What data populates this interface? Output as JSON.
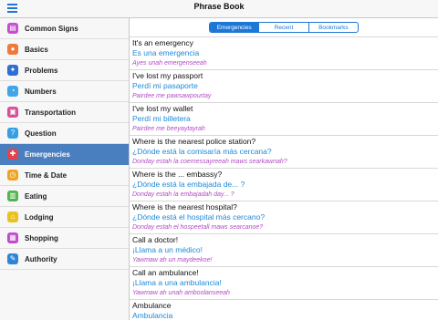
{
  "header": {
    "title": "Phrase Book"
  },
  "sidebar": {
    "items": [
      {
        "label": "Common Signs",
        "icon": "signs-icon",
        "color": "#c94bd1",
        "glyph": "▤"
      },
      {
        "label": "Basics",
        "icon": "chat-icon",
        "color": "#f07a3c",
        "glyph": "●"
      },
      {
        "label": "Problems",
        "icon": "problems-icon",
        "color": "#2d6fd3",
        "glyph": "✦"
      },
      {
        "label": "Numbers",
        "icon": "numbers-icon",
        "color": "#3fa6e8",
        "glyph": "◔"
      },
      {
        "label": "Transportation",
        "icon": "bus-icon",
        "color": "#d94d9a",
        "glyph": "▣"
      },
      {
        "label": "Question",
        "icon": "question-icon",
        "color": "#35a0e6",
        "glyph": "?"
      },
      {
        "label": "Emergencies",
        "icon": "emergency-icon",
        "color": "#e3434a",
        "glyph": "✚"
      },
      {
        "label": "Time & Date",
        "icon": "clock-icon",
        "color": "#f1a421",
        "glyph": "◷"
      },
      {
        "label": "Eating",
        "icon": "eating-icon",
        "color": "#4fb54f",
        "glyph": "▥"
      },
      {
        "label": "Lodging",
        "icon": "home-icon",
        "color": "#e8c21e",
        "glyph": "⌂"
      },
      {
        "label": "Shopping",
        "icon": "cart-icon",
        "color": "#c14bd0",
        "glyph": "▦"
      },
      {
        "label": "Authority",
        "icon": "pen-icon",
        "color": "#2f86d6",
        "glyph": "✎"
      }
    ],
    "selected_index": 6
  },
  "tabs": [
    {
      "label": "Emergencies",
      "active": true
    },
    {
      "label": "Recent",
      "active": false
    },
    {
      "label": "Bookmarks",
      "active": false
    }
  ],
  "phrases": [
    {
      "en": "It's an emergency",
      "es": "Es una emergencia",
      "pron": "Ayes unah emergenseeah"
    },
    {
      "en": "I've lost my passport",
      "es": "Perdí mi pasaporte",
      "pron": "Pairdee me pawsawpourtay"
    },
    {
      "en": "I've lost my wallet",
      "es": "Perdí mi billetera",
      "pron": "Pairdee me beeyaytayrah"
    },
    {
      "en": "Where is the nearest police station?",
      "es": "¿Dónde está la comisaría más cercana?",
      "pron": "Donday estah la coemessayreeah maws searkawnah?"
    },
    {
      "en": "Where is the ... embassy?",
      "es": "¿Dónde está la embajada de... ?",
      "pron": "Donday estah la embajadah day... ?"
    },
    {
      "en": "Where is the nearest hospital?",
      "es": "¿Dónde está el hospital más cercano?",
      "pron": "Donday estah el hospeetall maws searcanoe?"
    },
    {
      "en": "Call a doctor!",
      "es": "¡Llama a un médico!",
      "pron": "Yawmaw ah un maydeekoe!"
    },
    {
      "en": "Call an ambulance!",
      "es": "¡Llama a una ambulancia!",
      "pron": "Yawmaw ah unah amboolanseeah"
    },
    {
      "en": "Ambulance",
      "es": "Ambulancia",
      "pron": ""
    }
  ]
}
